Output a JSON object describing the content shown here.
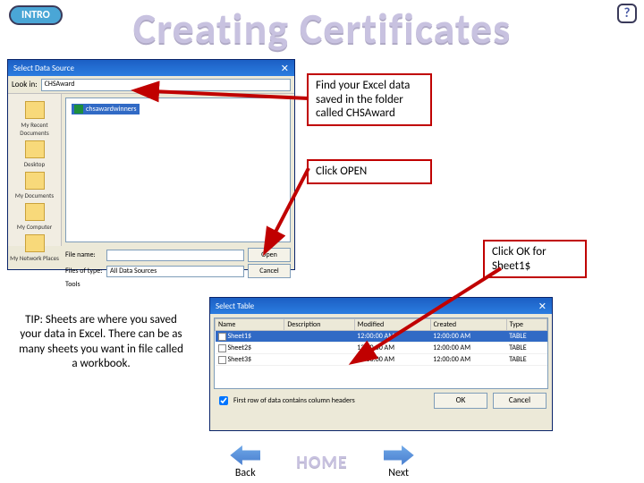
{
  "badge": "INTRO",
  "help": "?",
  "title": "Creating Certificates",
  "callouts": {
    "c1": "Find your Excel data saved in the folder called CHSAward",
    "c2": "Click OPEN",
    "c3": "Click OK for Sheet1$"
  },
  "tip": "TIP: Sheets are where you saved your data in Excel.\nThere can be as many sheets you want in file called a workbook.",
  "dlg1": {
    "title": "Select Data Source",
    "lookin_label": "Look in:",
    "lookin_value": "CHSAward",
    "places": [
      "My Recent Documents",
      "Desktop",
      "My Documents",
      "My Computer",
      "My Network Places"
    ],
    "file": "chsawardwinners",
    "filename_label": "File name:",
    "filetype_label": "Files of type:",
    "filetype_value": "All Data Sources",
    "open": "Open",
    "cancel": "Cancel",
    "tools": "Tools"
  },
  "dlg2": {
    "title": "Select Table",
    "cols": [
      "Name",
      "Description",
      "Modified",
      "Created",
      "Type"
    ],
    "rows": [
      {
        "name": "Sheet1$",
        "desc": "",
        "mod": "12:00:00 AM",
        "cre": "12:00:00 AM",
        "type": "TABLE"
      },
      {
        "name": "Sheet2$",
        "desc": "",
        "mod": "12:00:00 AM",
        "cre": "12:00:00 AM",
        "type": "TABLE"
      },
      {
        "name": "Sheet3$",
        "desc": "",
        "mod": "12:00:00 AM",
        "cre": "12:00:00 AM",
        "type": "TABLE"
      }
    ],
    "checkbox": "First row of data contains column headers",
    "ok": "OK",
    "cancel": "Cancel"
  },
  "nav": {
    "back": "Back",
    "home": "HOME",
    "next": "Next"
  }
}
